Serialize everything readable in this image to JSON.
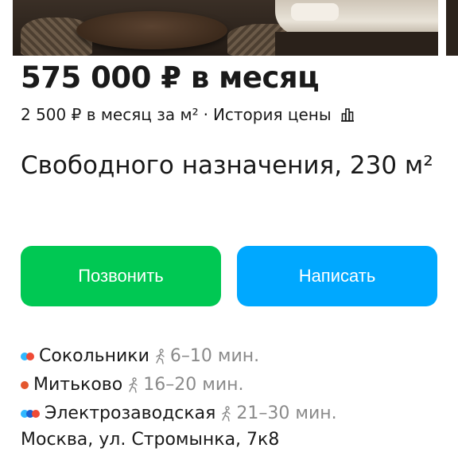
{
  "listing": {
    "price": "575 000 ₽ в месяц",
    "price_per_m2": "2 500 ₽ в месяц за м²",
    "separator": "·",
    "price_history_link": "История цены",
    "title": "Свободного назначения, 230 м²"
  },
  "actions": {
    "call_label": "Позвонить",
    "write_label": "Написать",
    "call_color": "#00c853",
    "write_color": "#00a8ff"
  },
  "metro": [
    {
      "name": "Сокольники",
      "time": "6–10 мин.",
      "line_colors": [
        "#30b7ff",
        "#ef4a36"
      ]
    },
    {
      "name": "Митьково",
      "time": "16–20 мин.",
      "line_colors": [
        "#e4572e"
      ]
    },
    {
      "name": "Электрозаводская",
      "time": "21–30 мин.",
      "line_colors": [
        "#30b7ff",
        "#1d5fd1",
        "#ef4a36"
      ]
    }
  ],
  "address": "Москва, ул. Стромынка, 7к8",
  "icons": {
    "history": "bar-chart-icon",
    "walk": "walking-person-icon",
    "metro": "metro-line-dot-icon"
  }
}
